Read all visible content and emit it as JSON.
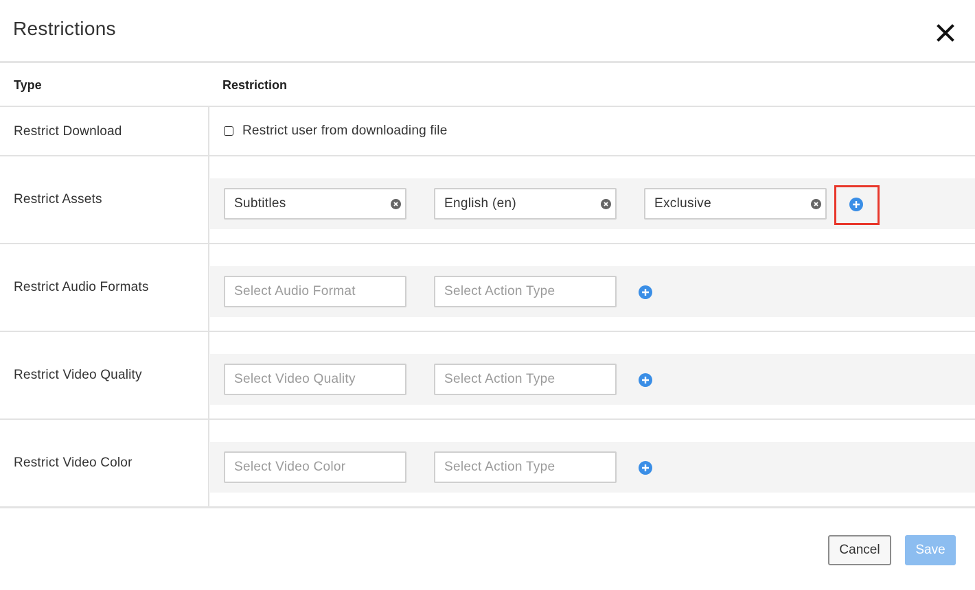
{
  "dialog": {
    "title": "Restrictions"
  },
  "table": {
    "headers": {
      "type": "Type",
      "restriction": "Restriction"
    },
    "rows": [
      {
        "label": "Restrict Download",
        "checkbox_label": "Restrict user from downloading file",
        "checked": false
      },
      {
        "label": "Restrict Assets",
        "fields": [
          "Subtitles",
          "English (en)",
          "Exclusive"
        ]
      },
      {
        "label": "Restrict Audio Formats",
        "placeholders": [
          "Select Audio Format",
          "Select Action Type"
        ]
      },
      {
        "label": "Restrict Video Quality",
        "placeholders": [
          "Select Video Quality",
          "Select Action Type"
        ]
      },
      {
        "label": "Restrict Video Color",
        "placeholders": [
          "Select Video Color",
          "Select Action Type"
        ]
      }
    ]
  },
  "footer": {
    "cancel_label": "Cancel",
    "save_label": "Save"
  },
  "icons": {
    "close": "close-icon",
    "clear": "clear-circle-icon",
    "add": "plus-circle-icon"
  },
  "colors": {
    "accent": "#3a8ee6",
    "save_disabled": "#8cbdf0",
    "highlight": "#e8372b"
  }
}
